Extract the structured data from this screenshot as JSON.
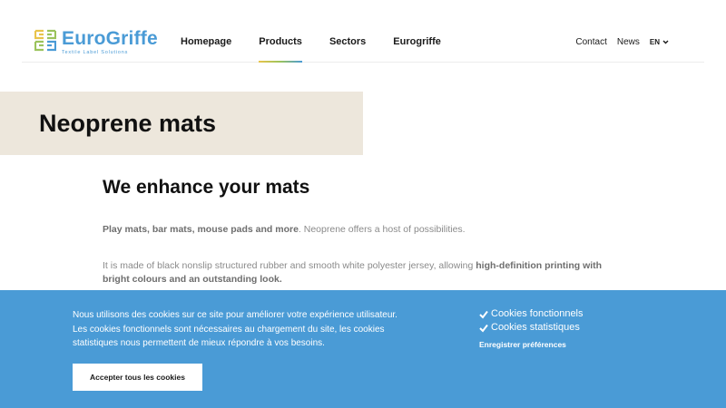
{
  "brand": {
    "name_part1": "Euro",
    "name_part2": "Griffe",
    "tagline": "Textile Label Solutions",
    "color": "#4a9bd6"
  },
  "nav": {
    "items": [
      {
        "label": "Homepage",
        "active": false
      },
      {
        "label": "Products",
        "active": true
      },
      {
        "label": "Sectors",
        "active": false
      },
      {
        "label": "Eurogriffe",
        "active": false
      }
    ]
  },
  "utility": {
    "contact": "Contact",
    "news": "News",
    "language": "EN"
  },
  "page": {
    "title": "Neoprene mats",
    "heading": "We enhance your mats",
    "p1_bold": "Play mats, bar mats, mouse pads and more",
    "p1_rest": ". Neoprene offers a host of possibilities.",
    "p2_start": "It is made of black nonslip structured rubber and smooth white polyester jersey, allowing ",
    "p2_bold": "high-definition printing with bright colours and an outstanding look."
  },
  "cookie": {
    "line1": "Nous utilisons des cookies sur ce site pour améliorer votre expérience utilisateur.",
    "line2": "Les cookies fonctionnels sont nécessaires au chargement du site, les cookies",
    "line3": "statistiques nous permettent de mieux répondre à vos besoins.",
    "opt_functional": "Cookies fonctionnels",
    "opt_stats": "Cookies statistiques",
    "save": "Enregistrer préférences",
    "accept": "Accepter tous les cookies",
    "bg_color": "#4a9bd6"
  },
  "icons": [
    "logo-mark-icon",
    "chevron-down-icon",
    "check-icon"
  ]
}
